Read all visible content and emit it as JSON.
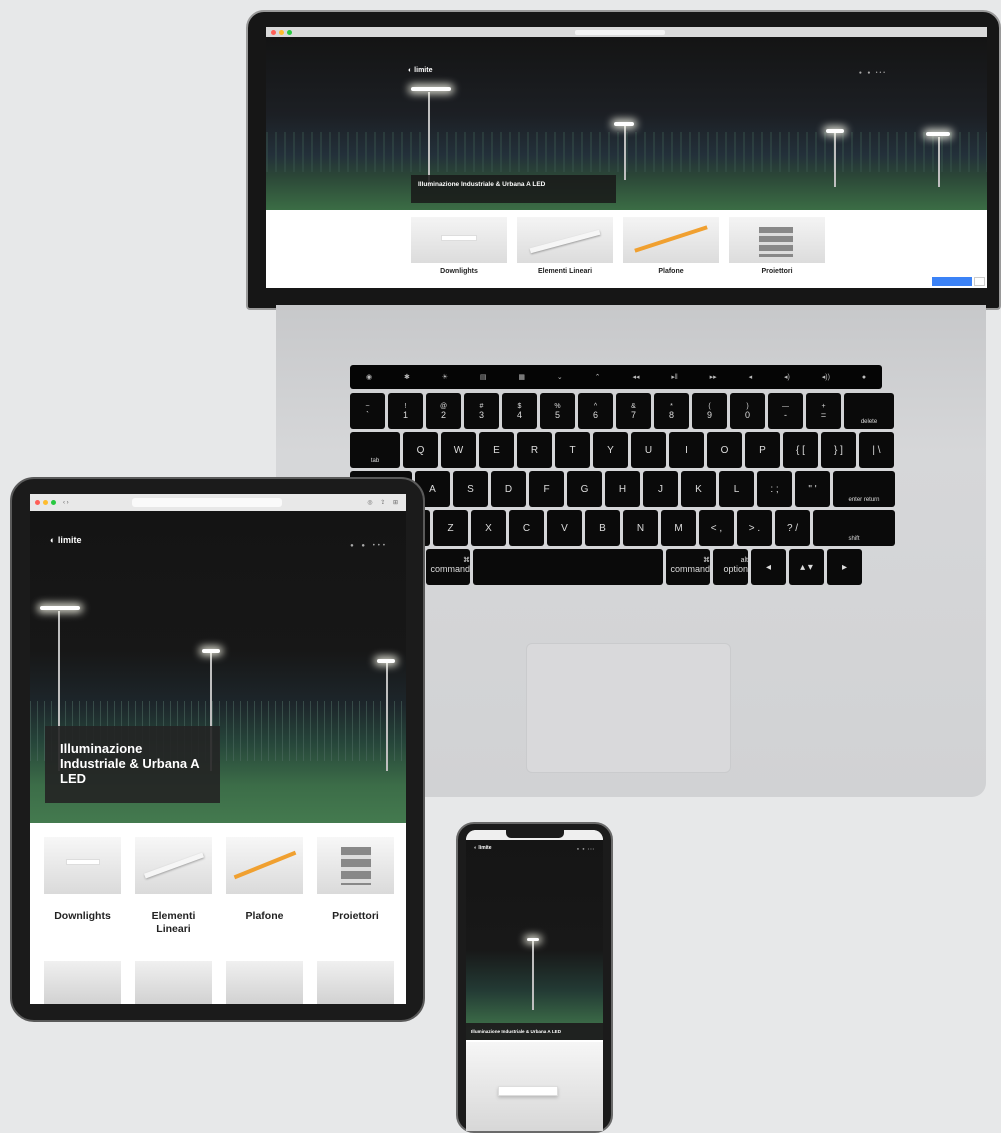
{
  "hero_title": "Illuminazione Industriale & Urbana A LED",
  "hero_title_tablet_lines": [
    "Illuminazione",
    "Industriale & Urbana A",
    "LED"
  ],
  "products": [
    {
      "label": "Downlights"
    },
    {
      "label": "Elementi Lineari"
    },
    {
      "label": "Plafone"
    },
    {
      "label": "Proiettori"
    }
  ],
  "tablet_products": [
    {
      "line1": "Downlights",
      "line2": ""
    },
    {
      "line1": "Elementi",
      "line2": "Lineari"
    },
    {
      "line1": "Plafone",
      "line2": ""
    },
    {
      "line1": "Proiettori",
      "line2": ""
    }
  ],
  "keyboard": {
    "row1": [
      [
        "~",
        "`"
      ],
      [
        "!",
        "1"
      ],
      [
        "@",
        "2"
      ],
      [
        "#",
        "3"
      ],
      [
        "$",
        "4"
      ],
      [
        "%",
        "5"
      ],
      [
        "^",
        "6"
      ],
      [
        "&",
        "7"
      ],
      [
        "*",
        "8"
      ],
      [
        "(",
        "9"
      ],
      [
        ")",
        "0"
      ],
      [
        "—",
        "-"
      ],
      [
        "+",
        "="
      ],
      [
        "delete",
        ""
      ]
    ],
    "row2": [
      "tab",
      "Q",
      "W",
      "E",
      "R",
      "T",
      "Y",
      "U",
      "I",
      "O",
      "P",
      "{ [",
      "} ]",
      "| \\"
    ],
    "row3": [
      "A",
      "S",
      "D",
      "F",
      "G",
      "H",
      "J",
      "K",
      "L",
      ": ;",
      "\" '",
      "enter return"
    ],
    "row4": [
      "Z",
      "X",
      "C",
      "V",
      "B",
      "N",
      "M",
      "< ,",
      "> .",
      "? /",
      "shift"
    ],
    "row5": [
      [
        "alt",
        "option"
      ],
      [
        "⌘",
        "command"
      ],
      [
        "",
        ""
      ],
      [
        "⌘",
        "command"
      ],
      [
        "alt",
        "option"
      ]
    ]
  },
  "colors": {
    "lamp": "#ffffff",
    "court": "#3d6f47",
    "cookie": "#3b82f6",
    "accent_orange": "#f0a030"
  }
}
